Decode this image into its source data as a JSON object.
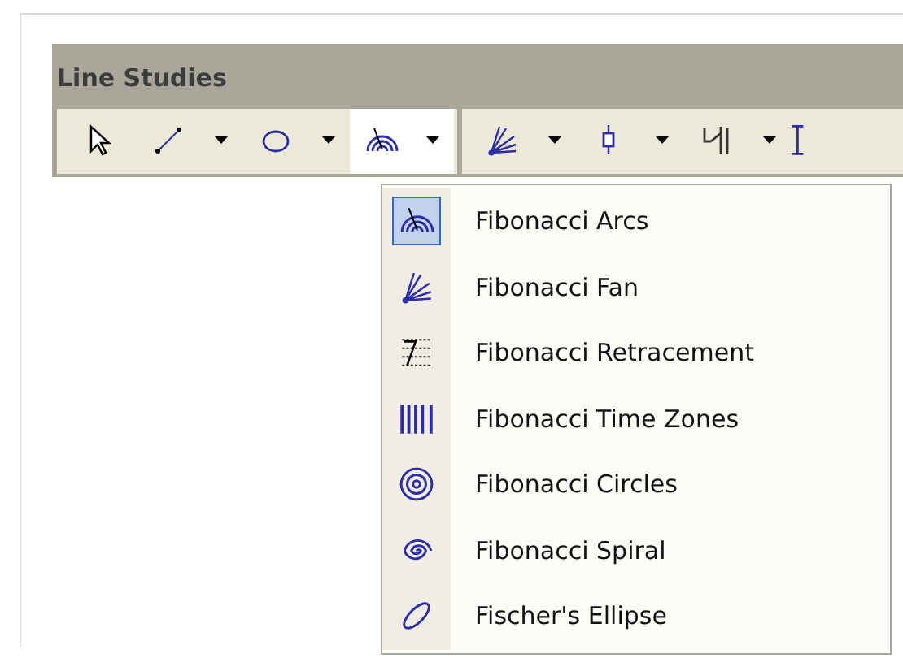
{
  "window": {
    "title": "Line Studies"
  },
  "tools": [
    {
      "dropdown": false,
      "selected": false
    },
    {
      "dropdown": true,
      "selected": false
    },
    {
      "dropdown": true,
      "selected": false
    },
    {
      "dropdown": true,
      "selected": true
    },
    {
      "dropdown": true,
      "selected": false
    },
    {
      "dropdown": true,
      "selected": false
    },
    {
      "dropdown": true,
      "selected": false
    },
    {
      "dropdown": false,
      "selected": false
    }
  ],
  "menu": [
    {
      "label": "Fibonacci Arcs",
      "selected": true
    },
    {
      "label": "Fibonacci Fan",
      "selected": false
    },
    {
      "label": "Fibonacci Retracement",
      "selected": false
    },
    {
      "label": "Fibonacci Time Zones",
      "selected": false
    },
    {
      "label": "Fibonacci Circles",
      "selected": false
    },
    {
      "label": "Fibonacci Spiral",
      "selected": false
    },
    {
      "label": "Fischer's Ellipse",
      "selected": false
    }
  ]
}
